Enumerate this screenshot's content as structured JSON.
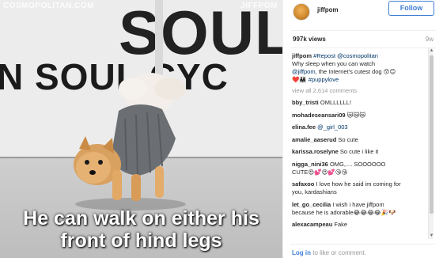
{
  "video": {
    "watermark_left": "COSMOPOLITAN.COM",
    "watermark_right": "JIFFPOM",
    "wall_text_top": "SOUL S",
    "wall_text_bottom": "N SOUL CYC",
    "caption_line1": "He can walk on either his",
    "caption_line2": "front of hind legs"
  },
  "post": {
    "username": "jiffpom",
    "follow_label": "Follow",
    "views": "997k views",
    "age": "9w",
    "caption_user": "jiffpom",
    "caption_tags": "#Repost @cosmopolitan",
    "caption_line2": "Why sleep when you can watch",
    "caption_line3_mention": "@jiffpom",
    "caption_line3_rest": ", the Internet's cutest dog 😚😊",
    "caption_line4_emoji": "❤️👨‍👩‍👧",
    "caption_line4_tag": "#puppylove",
    "view_all": "view all 2,614 comments",
    "comments": [
      {
        "user": "bby_tristi",
        "text": "OMLLLLLL!"
      },
      {
        "user": "mohadeseansari09",
        "text": "😿😿😿"
      },
      {
        "user": "elina.fee",
        "text": "@_girl_003"
      },
      {
        "user": "amalie_aaserud",
        "text": "So cute"
      },
      {
        "user": "karissa.roselyne",
        "text": "So cute i like it"
      },
      {
        "user": "nigga_nini36",
        "text": "OMG,.... SOOOOOO"
      },
      {
        "user": "",
        "text": "CUTE😍💕😍💕😘😘"
      },
      {
        "user": "safaxoo",
        "text": "I love how he said im coming for"
      },
      {
        "user": "",
        "text": "you, kardashians"
      },
      {
        "user": "let_go_cecilia",
        "text": "I wish i have jiffpom"
      },
      {
        "user": "",
        "text": "because he is adorable😂😂😂😂🎉🐶"
      },
      {
        "user": "alexacampeau",
        "text": "Fake"
      }
    ],
    "login_link": "Log in",
    "login_rest": " to like or comment."
  },
  "colors": {
    "accent_blue": "#3f7ed6",
    "link_navy": "#003569",
    "muted_gray": "#999999"
  }
}
